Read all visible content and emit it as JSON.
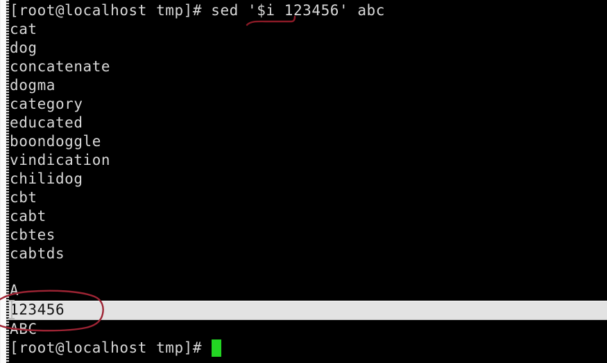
{
  "terminal": {
    "shell_prompt": "[root@localhost tmp]#",
    "lines": [
      {
        "text": "[root@localhost tmp]# sed '$i 123456' abc",
        "kind": "prompt-command"
      },
      {
        "text": "cat",
        "kind": "output"
      },
      {
        "text": "dog",
        "kind": "output"
      },
      {
        "text": "concatenate",
        "kind": "output"
      },
      {
        "text": "dogma",
        "kind": "output"
      },
      {
        "text": "category",
        "kind": "output"
      },
      {
        "text": "educated",
        "kind": "output"
      },
      {
        "text": "boondoggle",
        "kind": "output"
      },
      {
        "text": "vindication",
        "kind": "output"
      },
      {
        "text": "chilidog",
        "kind": "output"
      },
      {
        "text": "cbt",
        "kind": "output"
      },
      {
        "text": "cabt",
        "kind": "output"
      },
      {
        "text": "cbtes",
        "kind": "output"
      },
      {
        "text": "cabtds",
        "kind": "output"
      },
      {
        "text": "",
        "kind": "blank"
      },
      {
        "text": "A",
        "kind": "output"
      },
      {
        "text": "123456",
        "kind": "output-selected"
      },
      {
        "text": "ABC",
        "kind": "output"
      },
      {
        "text": "[root@localhost tmp]#",
        "kind": "prompt-cursor"
      }
    ],
    "command": {
      "prompt": "[root@localhost tmp]#",
      "program": "sed",
      "script": "'$i 123456'",
      "file": "abc"
    },
    "selected_line_text": "123456",
    "cursor": {
      "type": "block-cursor",
      "color": "#23d523"
    },
    "text_caret": {
      "type": "i-beam-caret"
    }
  },
  "annotations": [
    {
      "name": "underline-sed-script",
      "shape": "underline",
      "target_text": "$i 123456",
      "color": "#8a1a26"
    },
    {
      "name": "ellipse-output-line",
      "shape": "ellipse",
      "target_text": "123456",
      "color": "#9e2434"
    }
  ],
  "colors": {
    "background": "#000000",
    "foreground": "#d8d8d8",
    "selection_background": "#e3e3e3",
    "selection_foreground": "#141414",
    "cursor_green": "#23d523",
    "annotation_red": "#9e2434",
    "scrollbar_track": "#f0f0f0"
  }
}
